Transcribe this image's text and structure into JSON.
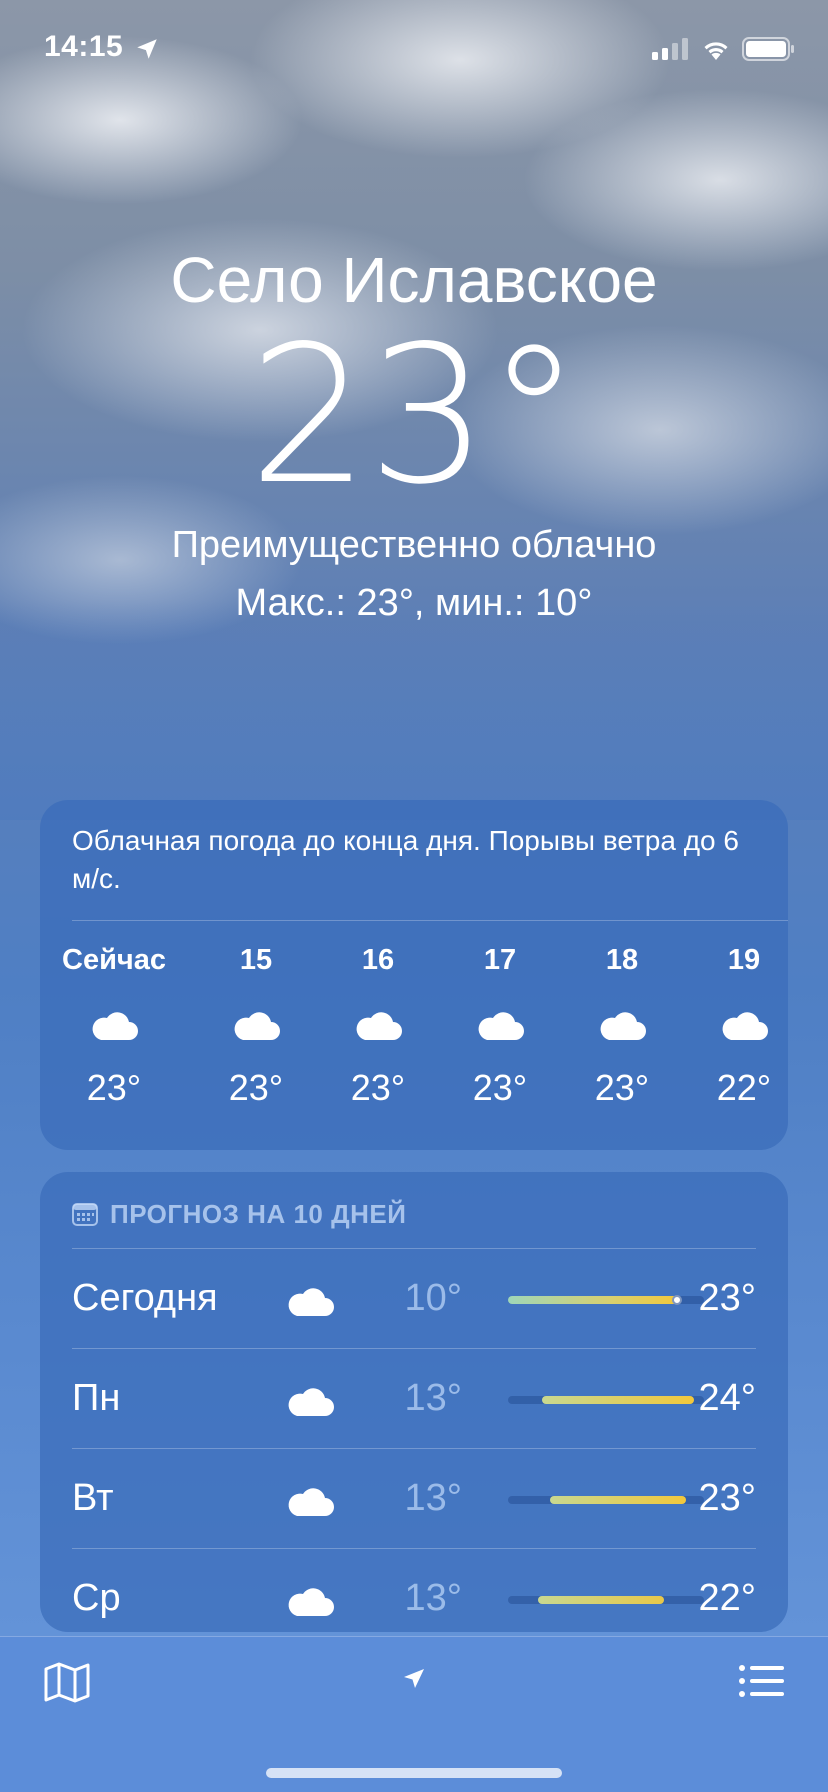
{
  "status_bar": {
    "time": "14:15",
    "icons": [
      "location-arrow-icon",
      "cellular-signal-icon",
      "wifi-icon",
      "battery-icon"
    ]
  },
  "current": {
    "city": "Село Иславское",
    "temperature": "23°",
    "condition": "Преимущественно облачно",
    "high_low": "Макс.: 23°, мин.: 10°"
  },
  "hourly": {
    "summary": "Облачная погода до конца дня. Порывы ветра до 6 м/с.",
    "items": [
      {
        "label": "Сейчас",
        "icon": "cloud-icon",
        "temp": "23°"
      },
      {
        "label": "15",
        "icon": "cloud-icon",
        "temp": "23°"
      },
      {
        "label": "16",
        "icon": "cloud-icon",
        "temp": "23°"
      },
      {
        "label": "17",
        "icon": "cloud-icon",
        "temp": "23°"
      },
      {
        "label": "18",
        "icon": "cloud-icon",
        "temp": "23°"
      },
      {
        "label": "19",
        "icon": "cloud-icon",
        "temp": "22°"
      }
    ]
  },
  "daily": {
    "header": "ПРОГНОЗ НА 10 ДНЕЙ",
    "header_icon": "calendar-icon",
    "days": [
      {
        "name": "Сегодня",
        "icon": "cloud-icon",
        "low": "10°",
        "high": "23°"
      },
      {
        "name": "Пн",
        "icon": "cloud-icon",
        "low": "13°",
        "high": "24°"
      },
      {
        "name": "Вт",
        "icon": "cloud-icon",
        "low": "13°",
        "high": "23°"
      },
      {
        "name": "Ср",
        "icon": "cloud-icon",
        "low": "13°",
        "high": "22°"
      }
    ]
  },
  "toolbar": {
    "icons": [
      "map-icon",
      "location-arrow-icon",
      "list-icon"
    ]
  },
  "colors": {
    "card_bg": "#3a6cba",
    "bar_cool": "#9fd6b8",
    "bar_warm": "#f2c83c",
    "low_temp_text": "#aac8f0"
  }
}
